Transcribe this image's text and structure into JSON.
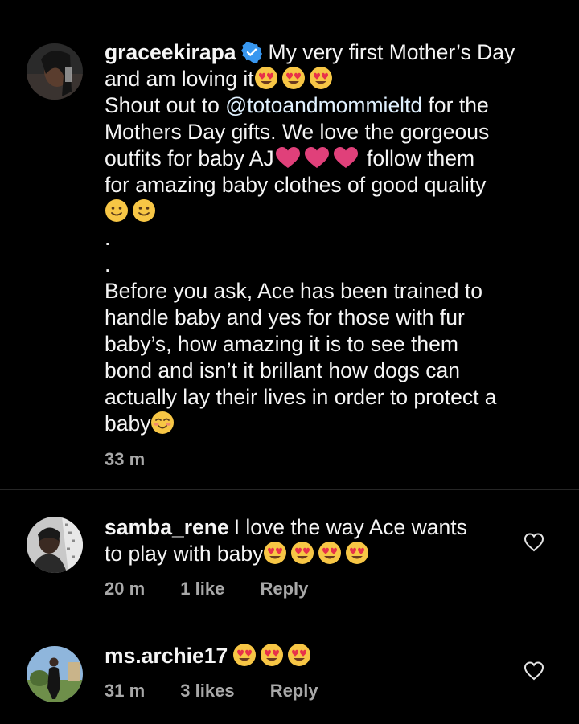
{
  "caption": {
    "username": "graceekirapa",
    "line1": "My very first Mother’s Day",
    "line2": "and am loving it",
    "line3a": "Shout out to ",
    "line3_mention": "@totoandmommieltd",
    "line3b": " for the",
    "line4": "Mothers Day gifts. We love the gorgeous",
    "line5a": "outfits for baby AJ",
    "line5b": " follow them",
    "line6": "for amazing baby clothes of good quality",
    "dot1": ".",
    "dot2": ".",
    "line8": "Before you ask, Ace has been trained to",
    "line9": "handle baby and yes for those with fur",
    "line10": "baby’s, how amazing it is to see them",
    "line11": "bond and isn’t it brillant how dogs can",
    "line12": "actually lay their lives in order to protect a",
    "line13": "baby",
    "time": "33 m"
  },
  "comments": [
    {
      "username": "samba_rene",
      "text1": "I love the way Ace wants",
      "text2": "to play with baby",
      "time": "20 m",
      "likes": "1 like",
      "reply": "Reply"
    },
    {
      "username": "ms.archie17",
      "time": "31 m",
      "likes": "3 likes",
      "reply": "Reply"
    }
  ],
  "colors": {
    "background": "#000000",
    "text": "#f5f5f5",
    "meta": "#a8a8a8",
    "verified": "#3897f0",
    "heart": "#e0407a"
  },
  "icons": [
    "verified-badge-icon",
    "heart-eyes-emoji",
    "pink-heart-emoji",
    "smiling-face-emoji",
    "blushing-face-emoji",
    "like-heart-icon"
  ]
}
